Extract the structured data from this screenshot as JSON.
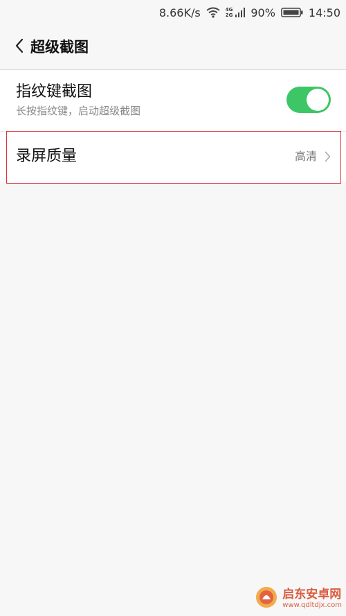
{
  "status_bar": {
    "network_speed": "8.66K/s",
    "signal_top": "4G",
    "signal_bottom": "2G",
    "battery_percent": "90%",
    "time": "14:50",
    "icons": [
      "wifi-icon",
      "signal-icon",
      "battery-icon"
    ]
  },
  "header": {
    "title": "超级截图",
    "back_icon": "chevron-left-icon"
  },
  "settings": {
    "fingerprint": {
      "title": "指纹键截图",
      "subtitle": "长按指纹键，启动超级截图",
      "toggle_on": true
    },
    "quality": {
      "title": "录屏质量",
      "value": "高清",
      "icon": "chevron-right-icon"
    }
  },
  "watermark": {
    "name": "启东安卓网",
    "url": "www.qdltdjx.com"
  },
  "colors": {
    "toggle_on": "#3cc665",
    "highlight_border": "#e0303a",
    "background": "#f7f7f7"
  }
}
